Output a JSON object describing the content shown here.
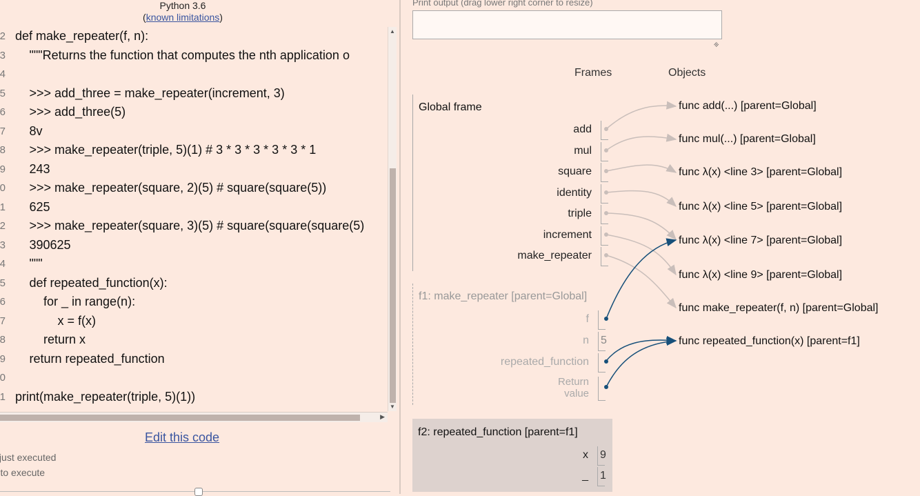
{
  "header": {
    "language": "Python 3.6",
    "limitations_link": "known limitations"
  },
  "code_lines": [
    {
      "no": "2",
      "text": "def make_repeater(f, n):",
      "indent": 0
    },
    {
      "no": "3",
      "text": "\"\"\"Returns the function that computes the nth application o",
      "indent": 1
    },
    {
      "no": "4",
      "text": "",
      "indent": 1
    },
    {
      "no": "5",
      "text": ">>> add_three = make_repeater(increment, 3)",
      "indent": 1
    },
    {
      "no": "6",
      "text": ">>> add_three(5)",
      "indent": 1
    },
    {
      "no": "7",
      "text": "8v",
      "indent": 1
    },
    {
      "no": "8",
      "text": ">>> make_repeater(triple, 5)(1) # 3 * 3 * 3 * 3 * 3 * 1",
      "indent": 1
    },
    {
      "no": "9",
      "text": "243",
      "indent": 1
    },
    {
      "no": "0",
      "text": ">>> make_repeater(square, 2)(5) # square(square(5))",
      "indent": 1
    },
    {
      "no": "1",
      "text": "625",
      "indent": 1
    },
    {
      "no": "2",
      "text": ">>> make_repeater(square, 3)(5) # square(square(square(5)",
      "indent": 1
    },
    {
      "no": "3",
      "text": "390625",
      "indent": 1
    },
    {
      "no": "4",
      "text": "\"\"\"",
      "indent": 1
    },
    {
      "no": "5",
      "text": "def repeated_function(x):",
      "indent": 1
    },
    {
      "no": "6",
      "text": "for _ in range(n):",
      "indent": 2
    },
    {
      "no": "7",
      "text": "x = f(x)",
      "indent": 3
    },
    {
      "no": "8",
      "text": "return x",
      "indent": 2
    },
    {
      "no": "9",
      "text": "return repeated_function",
      "indent": 1
    },
    {
      "no": "0",
      "text": "",
      "indent": 0
    },
    {
      "no": "1",
      "text": "print(make_repeater(triple, 5)(1))",
      "indent": 0
    }
  ],
  "edit_link": "Edit this code",
  "legend": {
    "just_executed": "e that just executed",
    "next_line": "xt line to execute"
  },
  "print_output_label": "Print output (drag lower right corner to resize)",
  "print_output_value": "",
  "frames_header": "Frames",
  "objects_header": "Objects",
  "global_frame": {
    "title": "Global frame",
    "vars": [
      "add",
      "mul",
      "square",
      "identity",
      "triple",
      "increment",
      "make_repeater"
    ]
  },
  "f1_frame": {
    "title": "f1: make_repeater [parent=Global]",
    "vars": [
      {
        "name": "f",
        "value": ""
      },
      {
        "name": "n",
        "value": "5"
      },
      {
        "name": "repeated_function",
        "value": ""
      }
    ],
    "return_label_1": "Return",
    "return_label_2": "value"
  },
  "f2_frame": {
    "title": "f2: repeated_function [parent=f1]",
    "vars": [
      {
        "name": "x",
        "value": "9"
      },
      {
        "name": "_",
        "value": "1"
      }
    ]
  },
  "objects": [
    "func add(...) [parent=Global]",
    "func mul(...) [parent=Global]",
    "func λ(x) <line 3> [parent=Global]",
    "func λ(x) <line 5> [parent=Global]",
    "func λ(x) <line 7> [parent=Global]",
    "func λ(x) <line 9> [parent=Global]",
    "func make_repeater(f, n) [parent=Global]",
    "func repeated_function(x) [parent=f1]"
  ],
  "colors": {
    "active_pointer": "#17507a",
    "inactive_pointer": "#c9beba",
    "background": "#fde9df"
  }
}
